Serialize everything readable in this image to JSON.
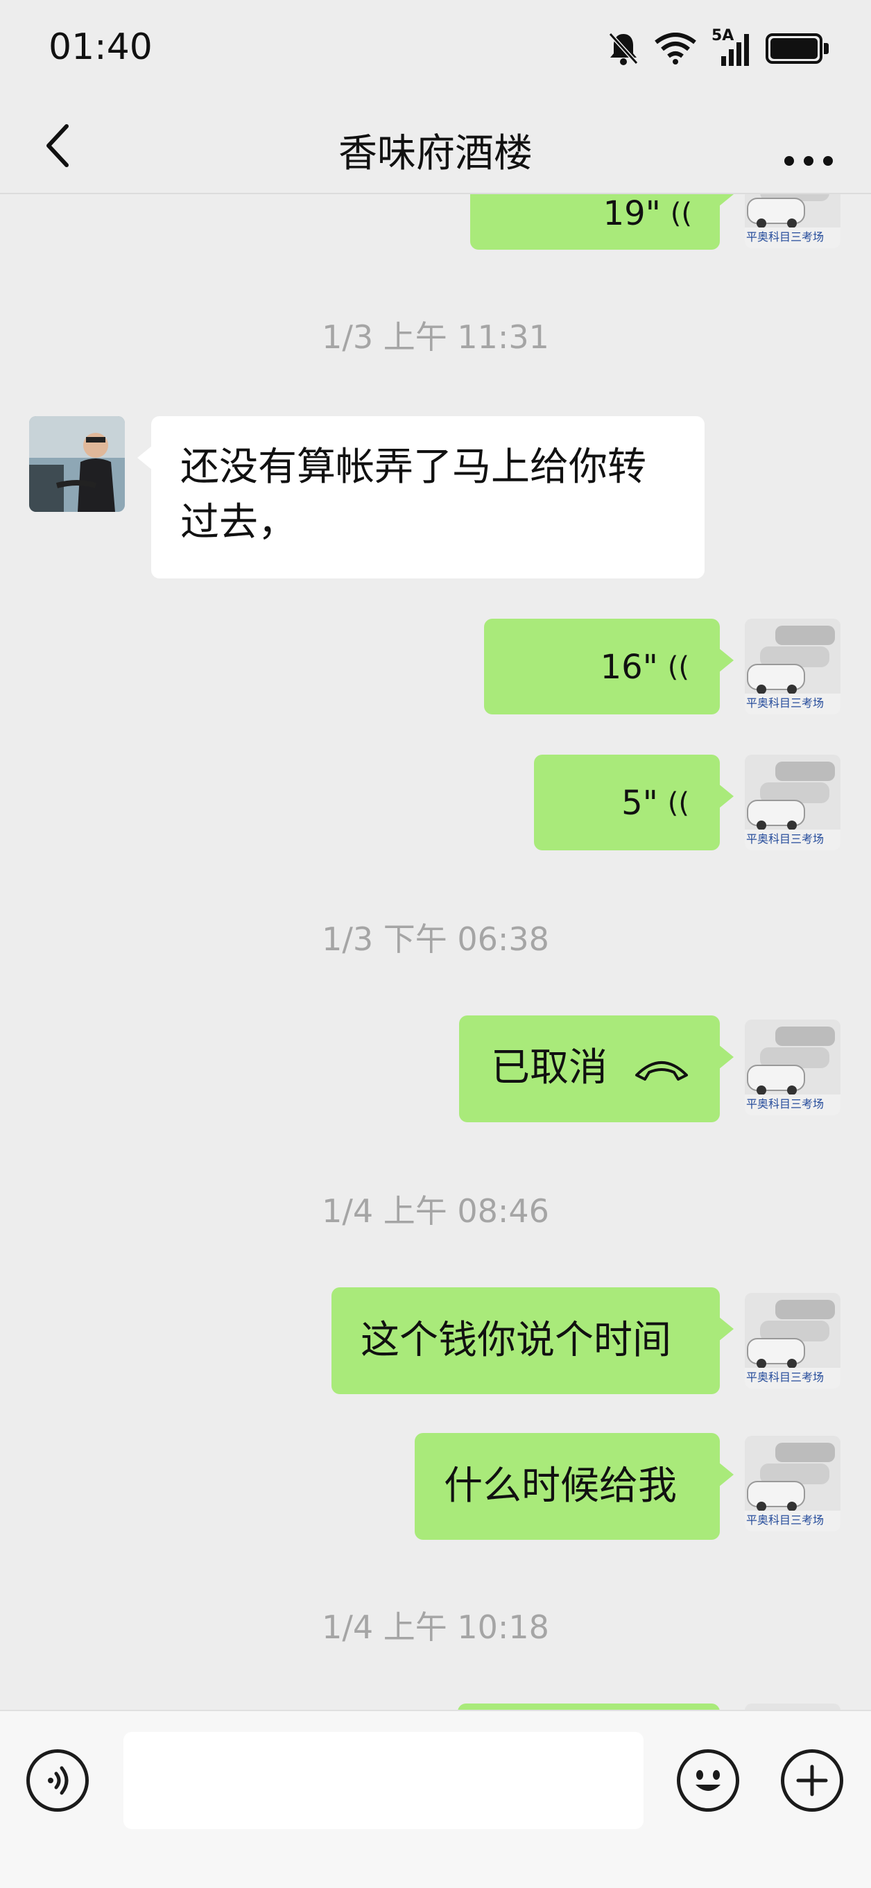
{
  "status": {
    "time": "01:40",
    "network": "5A",
    "icons": [
      "bell-mute-icon",
      "wifi-icon",
      "signal-icon",
      "battery-icon"
    ]
  },
  "nav": {
    "title": "香味府酒楼",
    "back_icon": "chevron-left-icon",
    "more_icon": "more-dots-icon"
  },
  "messages": {
    "top_voice": {
      "duration": "19\""
    },
    "ts1": "1/3 上午 11:31",
    "received_text": "还没有算帐弄了马上给你转过去，",
    "voice1": {
      "duration": "16\""
    },
    "voice2": {
      "duration": "5\""
    },
    "ts2": "1/3 下午 06:38",
    "call_label": "已取消",
    "ts3": "1/4 上午 08:46",
    "text1": "这个钱你说个时间",
    "text2": "什么时候给我",
    "ts4": "1/4 上午 10:18",
    "avatar_watermark": "平奥科目三考场"
  },
  "input_bar": {
    "placeholder": "",
    "voice_icon": "voice-input-icon",
    "emoji_icon": "emoji-icon",
    "plus_icon": "plus-icon"
  },
  "colors": {
    "background": "#ededed",
    "bubble_sent": "#a9ea7a",
    "bubble_received": "#ffffff",
    "timestamp": "#a5a5a5"
  }
}
